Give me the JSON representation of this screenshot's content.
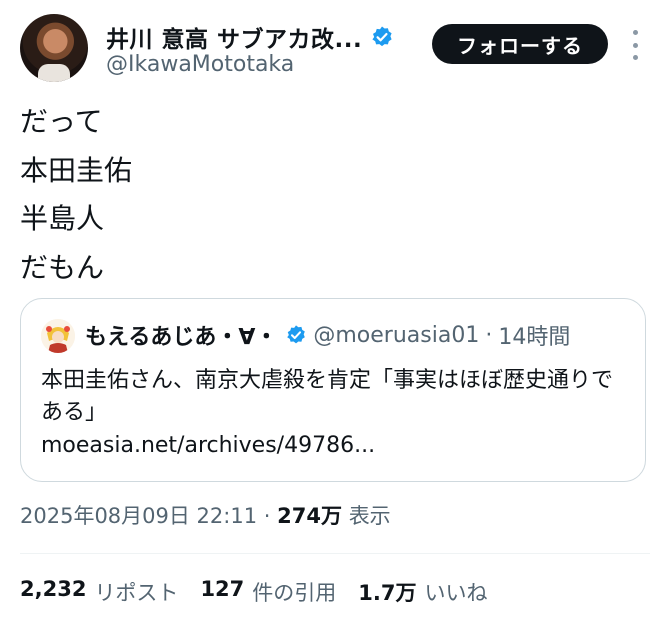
{
  "author": {
    "name": "井川 意高 サブアカ改...",
    "handle": "@IkawaMototaka",
    "verified_icon": "verified-badge-icon",
    "verified_color": "#1d9bf0"
  },
  "follow_button": {
    "label": "フォローする"
  },
  "tweet": {
    "lines": [
      "だって",
      "本田圭佑",
      "半島人",
      "だもん"
    ]
  },
  "quote": {
    "name": "もえるあじあ・∀・",
    "handle": "@moeruasia01",
    "separator": "·",
    "time": "14時間",
    "text": "本田圭佑さん、南京大虐殺を肯定「事実はほぼ歴史通りである」",
    "link": "moeasia.net/archives/49786..."
  },
  "meta": {
    "timestamp": "2025年08月09日 22:11",
    "separator": "·",
    "views_count": "274万",
    "views_label": "表示"
  },
  "stats": {
    "reposts_count": "2,232",
    "reposts_label": "リポスト",
    "quotes_count": "127",
    "quotes_label": "件の引用",
    "likes_count": "1.7万",
    "likes_label": "いいね"
  }
}
